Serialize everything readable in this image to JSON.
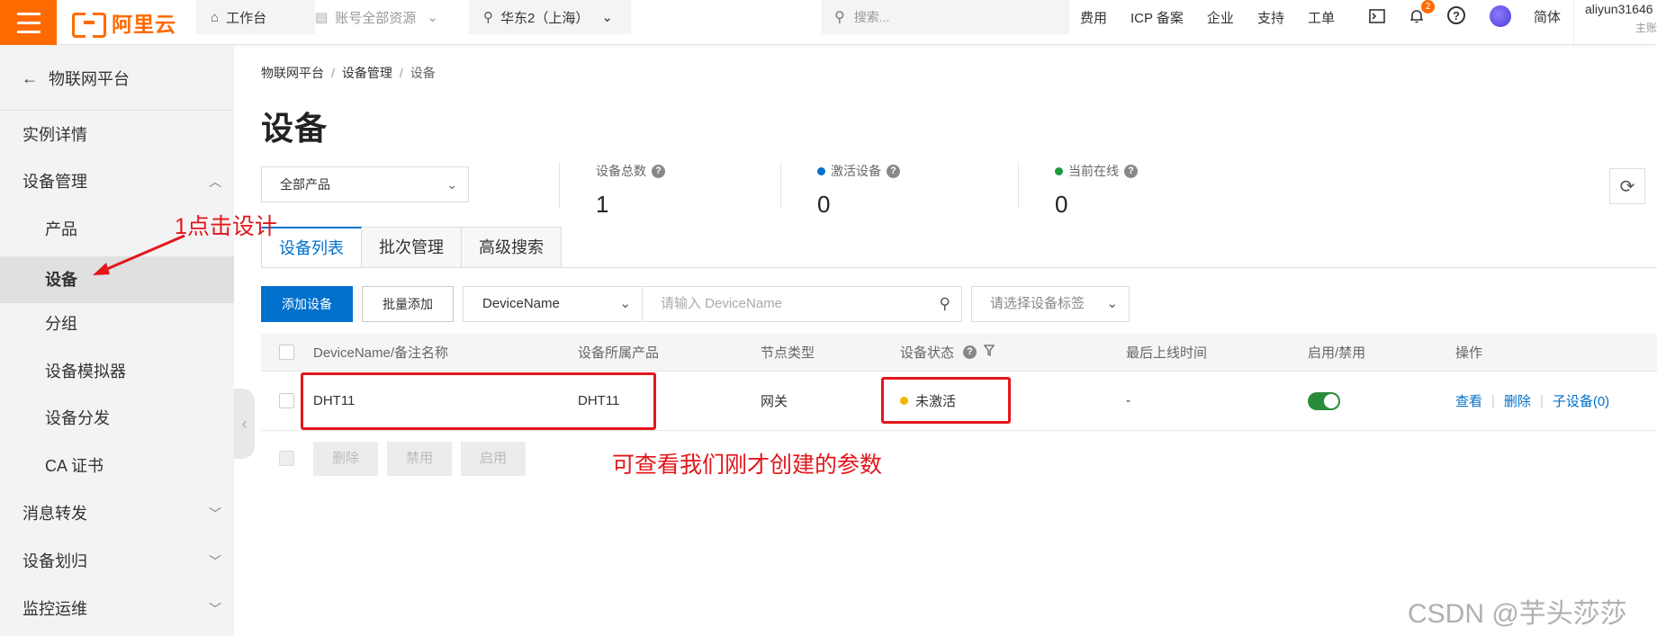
{
  "topbar": {
    "logo_text": "阿里云",
    "workbench": "工作台",
    "resource_scope": "账号全部资源",
    "region": "华东2（上海）",
    "search_placeholder": "搜索...",
    "links": [
      "费用",
      "ICP 备案",
      "企业",
      "支持",
      "工单"
    ],
    "notification_count": "2",
    "language": "简体",
    "username": "aliyun31646",
    "user_sub": "主账"
  },
  "sidebar": {
    "back_label": "物联网平台",
    "items": [
      {
        "label": "实例详情"
      },
      {
        "label": "设备管理",
        "expanded": true
      },
      {
        "label": "产品"
      },
      {
        "label": "设备",
        "active": true
      },
      {
        "label": "分组"
      },
      {
        "label": "设备模拟器"
      },
      {
        "label": "设备分发"
      },
      {
        "label": "CA 证书"
      },
      {
        "label": "消息转发"
      },
      {
        "label": "设备划归"
      },
      {
        "label": "监控运维"
      }
    ]
  },
  "breadcrumb": [
    "物联网平台",
    "设备管理",
    "设备"
  ],
  "page_title": "设备",
  "product_filter": "全部产品",
  "stats": {
    "total_label": "设备总数",
    "total_value": "1",
    "activated_label": "激活设备",
    "activated_value": "0",
    "online_label": "当前在线",
    "online_value": "0",
    "activated_color": "#0070cc",
    "online_color": "#1e9a3a"
  },
  "tabs": [
    "设备列表",
    "批次管理",
    "高级搜索"
  ],
  "toolbar": {
    "add_device": "添加设备",
    "batch_add": "批量添加",
    "field_select": "DeviceName",
    "search_placeholder": "请输入 DeviceName",
    "tag_select_placeholder": "请选择设备标签"
  },
  "table": {
    "headers": [
      "DeviceName/备注名称",
      "设备所属产品",
      "节点类型",
      "设备状态",
      "最后上线时间",
      "启用/禁用",
      "操作"
    ],
    "rows": [
      {
        "device_name": "DHT11",
        "product": "DHT11",
        "node_type": "网关",
        "status": "未激活",
        "status_color": "#f5b400",
        "last_online": "-",
        "enabled": true,
        "ops": [
          "查看",
          "删除",
          "子设备(0)"
        ]
      }
    ]
  },
  "bulk_actions": [
    "删除",
    "禁用",
    "启用"
  ],
  "annotations": {
    "click_hint": "1点击设计",
    "view_hint": "可查看我们刚才创建的参数"
  },
  "watermark": "CSDN @芋头莎莎"
}
